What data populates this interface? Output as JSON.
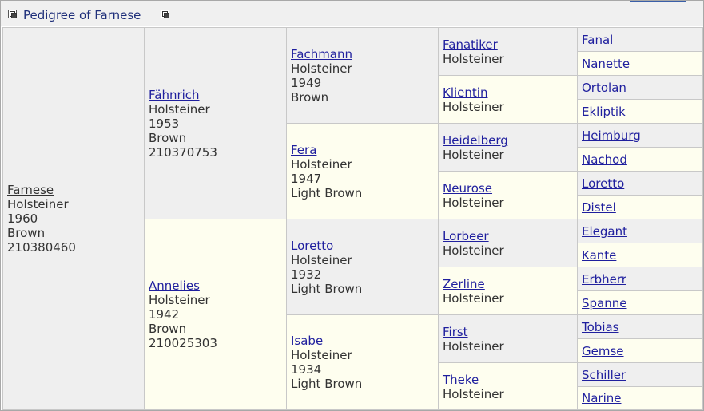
{
  "title": "Pedigree of Farnese",
  "subject": {
    "name": "Farnese",
    "breed": "Holsteiner",
    "year": "1960",
    "color": "Brown",
    "reg": "210380460"
  },
  "gen1": [
    {
      "name": "Fähnrich",
      "breed": "Holsteiner",
      "year": "1953",
      "color": "Brown",
      "reg": "210370753"
    },
    {
      "name": "Annelies",
      "breed": "Holsteiner",
      "year": "1942",
      "color": "Brown",
      "reg": "210025303"
    }
  ],
  "gen2": [
    {
      "name": "Fachmann",
      "breed": "Holsteiner",
      "year": "1949",
      "color": "Brown"
    },
    {
      "name": "Fera",
      "breed": "Holsteiner",
      "year": "1947",
      "color": "Light Brown"
    },
    {
      "name": "Loretto",
      "breed": "Holsteiner",
      "year": "1932",
      "color": "Light Brown"
    },
    {
      "name": "Isabe",
      "breed": "Holsteiner",
      "year": "1934",
      "color": "Light Brown"
    }
  ],
  "gen3": [
    {
      "name": "Fanatiker",
      "breed": "Holsteiner"
    },
    {
      "name": "Klientin",
      "breed": "Holsteiner"
    },
    {
      "name": "Heidelberg",
      "breed": "Holsteiner"
    },
    {
      "name": "Neurose",
      "breed": "Holsteiner"
    },
    {
      "name": "Lorbeer",
      "breed": "Holsteiner"
    },
    {
      "name": "Zerline",
      "breed": "Holsteiner"
    },
    {
      "name": "First",
      "breed": "Holsteiner"
    },
    {
      "name": "Theke",
      "breed": "Holsteiner"
    }
  ],
  "gen4": [
    "Fanal",
    "Nanette",
    "Ortolan",
    "Ekliptik",
    "Heimburg",
    "Nachod",
    "Loretto",
    "Distel",
    "Elegant",
    "Kante",
    "Erbherr",
    "Spanne",
    "Tobias",
    "Gemse",
    "Schiller",
    "Narine"
  ],
  "colors": {
    "link": "#1f1f9e",
    "text": "#333333",
    "grey_cell": "#efefef",
    "cream_cell": "#fefeef"
  }
}
